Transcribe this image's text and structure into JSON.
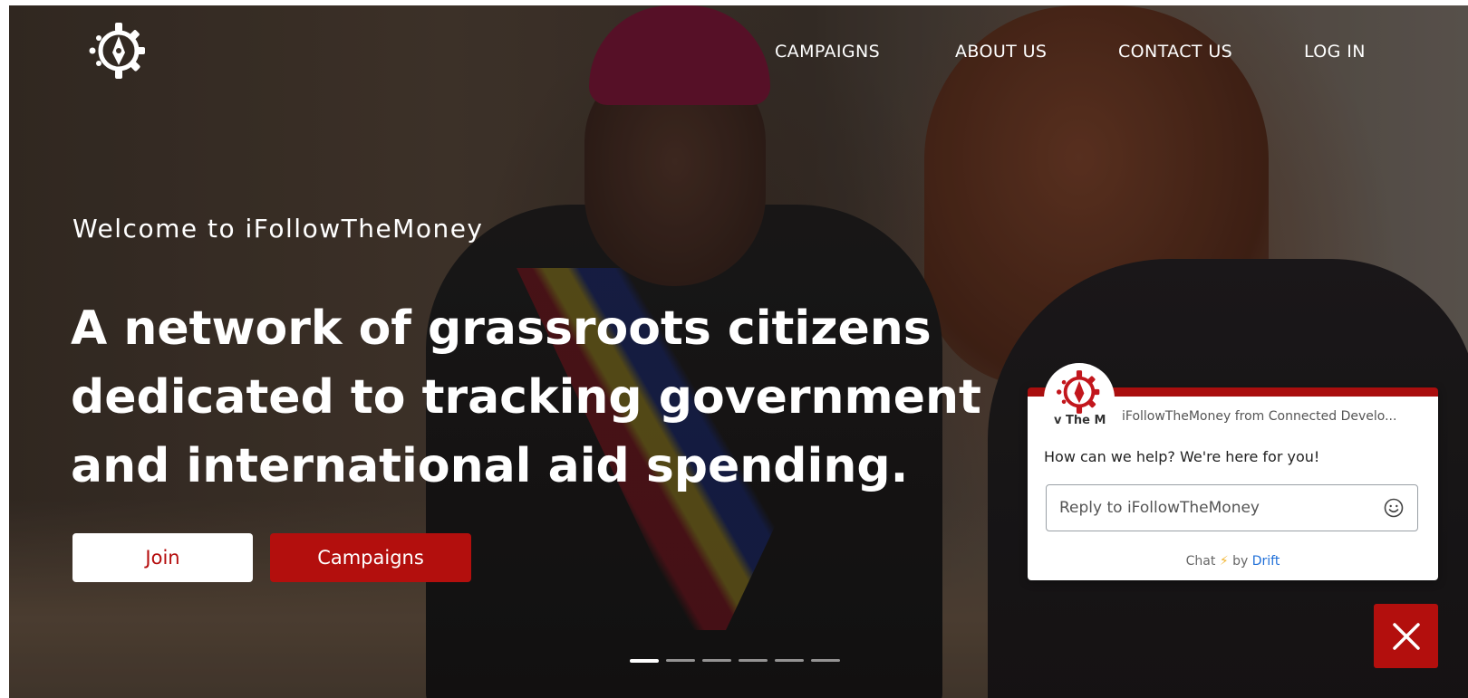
{
  "brand": {
    "logo_icon": "gear-compass-icon",
    "accent_red": "#b30f0d",
    "white": "#ffffff",
    "drift_blue": "#1e6ed8"
  },
  "nav": {
    "campaigns": "CAMPAIGNS",
    "about": "ABOUT US",
    "contact": "CONTACT US",
    "login": "LOG IN"
  },
  "hero": {
    "welcome": "Welcome to iFollowTheMoney",
    "headline_line1": "A network of grassroots citizens",
    "headline_line2": "dedicated to tracking government",
    "headline_line3": "and international aid spending.",
    "join_label": "Join",
    "campaigns_label": "Campaigns",
    "slides_total": 6,
    "active_slide": 1
  },
  "chat": {
    "avatar_caption": "v The M",
    "from": "iFollowTheMoney from Connected Develo...",
    "message": "How can we help? We're here for you!",
    "reply_placeholder": "Reply to iFollowTheMoney",
    "footer_chat": "Chat",
    "footer_bolt": "⚡",
    "footer_by": "by",
    "footer_drift": "Drift",
    "emoji_icon": "smiley-icon",
    "close_icon": "close-icon"
  }
}
